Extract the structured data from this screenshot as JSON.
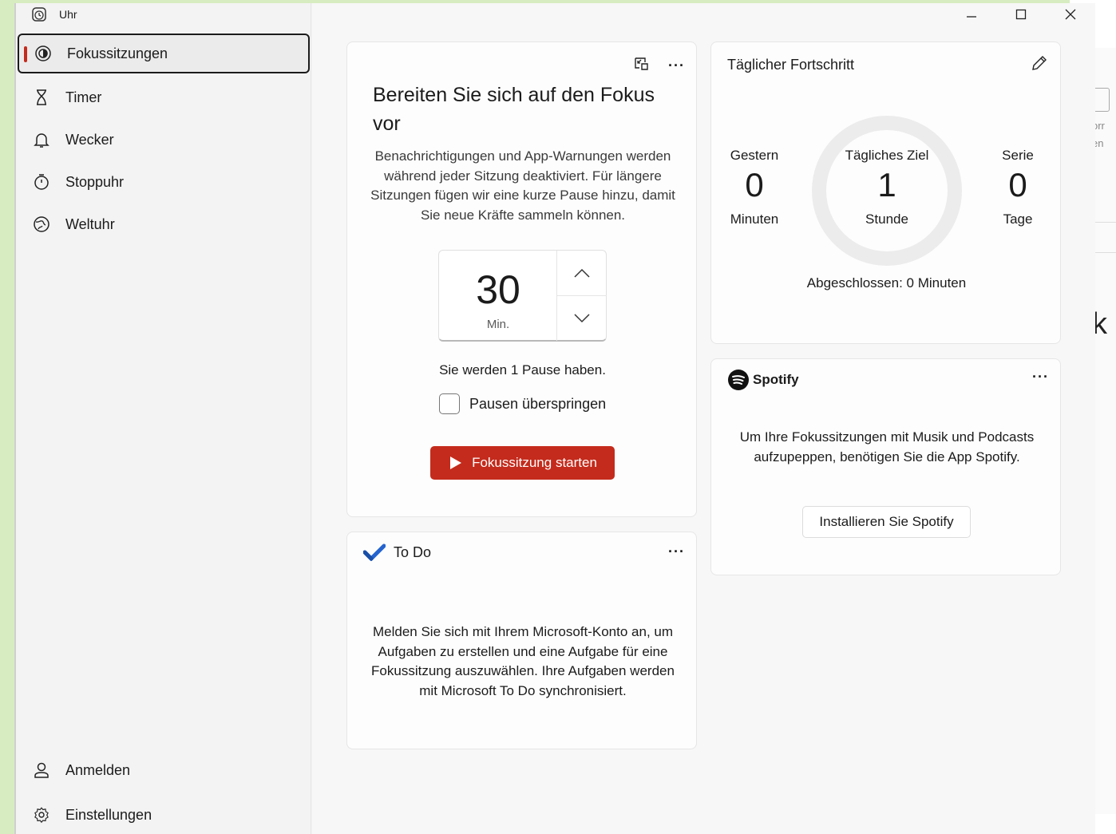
{
  "app": {
    "title": "Uhr"
  },
  "sidebar": {
    "items": [
      {
        "label": "Fokussitzungen",
        "icon": "focus-icon",
        "active": true
      },
      {
        "label": "Timer",
        "icon": "hourglass-icon"
      },
      {
        "label": "Wecker",
        "icon": "bell-icon"
      },
      {
        "label": "Stoppuhr",
        "icon": "stopwatch-icon"
      },
      {
        "label": "Weltuhr",
        "icon": "globe-icon"
      }
    ],
    "bottom": [
      {
        "label": "Anmelden",
        "icon": "user-icon"
      },
      {
        "label": "Einstellungen",
        "icon": "gear-icon"
      }
    ]
  },
  "focus": {
    "title": "Bereiten Sie sich auf den Fokus vor",
    "description": "Benachrichtigungen und App-Warnungen werden während jeder Sitzung deaktiviert. Für längere Sitzungen fügen wir eine kurze Pause hinzu, damit Sie neue Kräfte sammeln können.",
    "duration_value": "30",
    "duration_unit": "Min.",
    "pause_text": "Sie werden 1 Pause haben.",
    "skip_label": "Pausen überspringen",
    "skip_checked": false,
    "start_label": "Fokussitzung starten"
  },
  "todo": {
    "title": "To Do",
    "body": "Melden Sie sich mit Ihrem Microsoft-Konto an, um Aufgaben zu erstellen und eine Aufgabe für eine Fokussitzung auszuwählen. Ihre Aufgaben werden mit Microsoft To Do synchronisiert."
  },
  "progress": {
    "title": "Täglicher Fortschritt",
    "yesterday_label": "Gestern",
    "yesterday_value": "0",
    "yesterday_unit": "Minuten",
    "goal_label": "Tägliches Ziel",
    "goal_value": "1",
    "goal_unit": "Stunde",
    "streak_label": "Serie",
    "streak_value": "0",
    "streak_unit": "Tage",
    "completed": "Abgeschlossen: 0 Minuten"
  },
  "spotify": {
    "title": "Spotify",
    "body": "Um Ihre Fokussitzungen mit Musik und Podcasts aufzupeppen, benötigen Sie die App Spotify.",
    "install_label": "Installieren Sie Spotify"
  },
  "background": {
    "letter": "k",
    "frag1": "orr",
    "frag2": "en"
  },
  "colors": {
    "accent": "#c42b1c",
    "todo_blue": "#2564cf"
  }
}
